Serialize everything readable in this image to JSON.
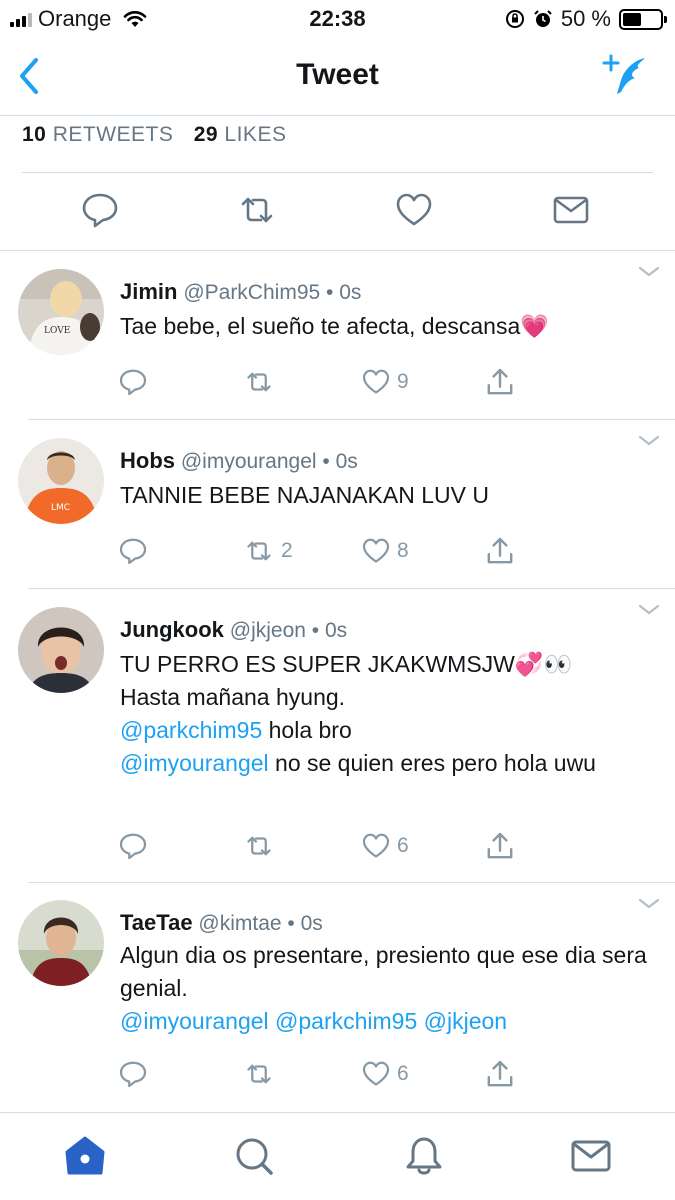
{
  "status_bar": {
    "carrier": "Orange",
    "time": "22:38",
    "battery_percent": "50 %",
    "battery_level": 0.5
  },
  "nav": {
    "title": "Tweet",
    "back_icon": "chevron-left-icon",
    "compose_icon": "compose-feather-icon"
  },
  "stats": {
    "retweets_count": "10",
    "retweets_label": "RETWEETS",
    "likes_count": "29",
    "likes_label": "LIKES"
  },
  "replies": [
    {
      "name": "Jimin",
      "handle": "@ParkChim95",
      "time": "0s",
      "text": "Tae bebe, el sueño te afecta, descansa💗",
      "retweets": "",
      "likes": "9"
    },
    {
      "name": "Hobs",
      "handle": "@imyourangel",
      "time": "0s",
      "text": "TANNIE BEBE NAJANAKAN LUV U",
      "retweets": "2",
      "likes": "8"
    },
    {
      "name": "Jungkook",
      "handle": "@jkjeon",
      "time": "0s",
      "text_line1": "TU PERRO ES SUPER JKAKWMSJW💞👀",
      "text_line2": "Hasta mañana hyung.",
      "mention1": "@parkchim95",
      "mention1_text": " hola bro",
      "mention2": "@imyourangel",
      "mention2_text": " no se quien eres pero hola uwu",
      "retweets": "",
      "likes": "6"
    },
    {
      "name": "TaeTae",
      "handle": "@kimtae",
      "time": "0s",
      "text": "Algun dia os presentare, presiento que ese dia sera genial.",
      "mentions": "@imyourangel @parkchim95 @jkjeon",
      "retweets": "",
      "likes": "6"
    }
  ],
  "separator": "•",
  "colors": {
    "accent": "#1da1f2",
    "tab_active": "#2a63c8",
    "muted": "#657786",
    "icon_gray": "#8899a6"
  },
  "tab_bar": {
    "items": [
      "home-icon",
      "search-icon",
      "notifications-bell-icon",
      "messages-mail-icon"
    ]
  }
}
